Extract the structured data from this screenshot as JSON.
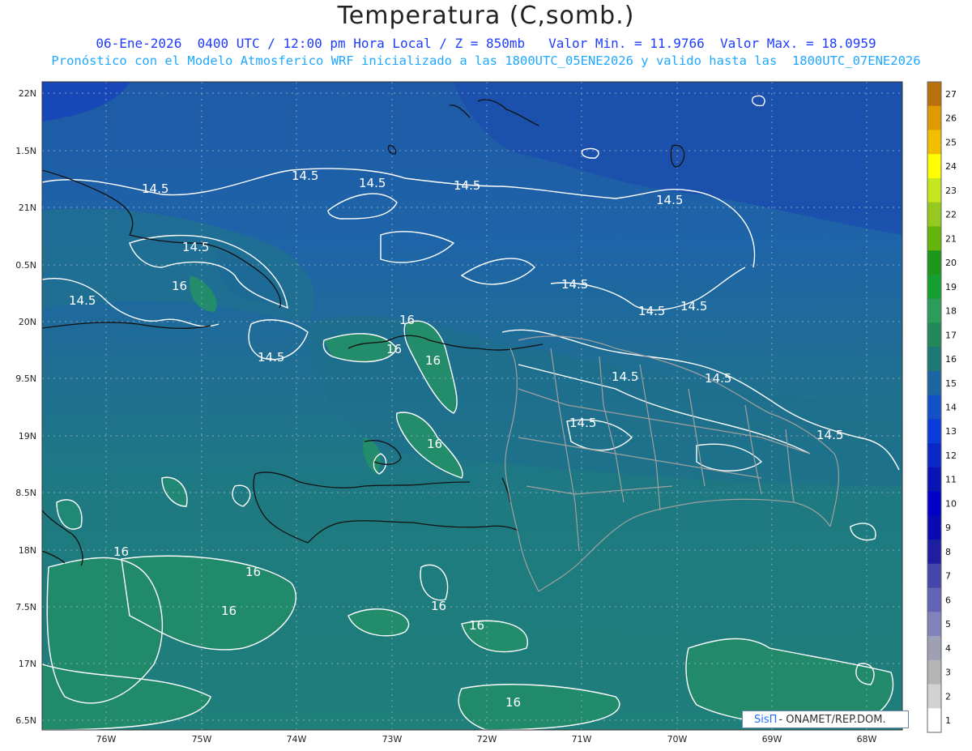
{
  "title": "Temperatura (C,somb.)",
  "subtitle_line1": "06-Ene-2026  0400 UTC / 12:00 pm Hora Local / Z = 850mb   Valor Min. = 11.9766  Valor Max. = 18.0959",
  "subtitle_line2": "Pronóstico con el Modelo Atmosferico WRF inicializado a las 1800UTC_05ENE2026 y valido hasta las  1800UTC_07ENE2026",
  "lat_labels": [
    "22N",
    "1.5N",
    "21N",
    "0.5N",
    "20N",
    "9.5N",
    "19N",
    "8.5N",
    "18N",
    "7.5N",
    "17N",
    "6.5N"
  ],
  "lon_labels": [
    "76W",
    "75W",
    "74W",
    "73W",
    "72W",
    "71W",
    "70W",
    "69W",
    "68W"
  ],
  "colorbar": {
    "levels": [
      "27",
      "26",
      "25",
      "24",
      "23",
      "22",
      "21",
      "20",
      "19",
      "18",
      "17",
      "16",
      "15",
      "14",
      "13",
      "12",
      "11",
      "10",
      "9",
      "8",
      "7",
      "6",
      "5",
      "4",
      "3",
      "2",
      "1"
    ],
    "colors": [
      "#b8700a",
      "#e09a00",
      "#f0c000",
      "#ffff00",
      "#c8e61e",
      "#96c81e",
      "#64b40a",
      "#1e9619",
      "#14a032",
      "#2d9b5a",
      "#23875a",
      "#1e7873",
      "#1e64a0",
      "#1450c8",
      "#0a3cdc",
      "#0a28c8",
      "#0a14b4",
      "#0000c8",
      "#0a0ab4",
      "#1e1ea0",
      "#4646aa",
      "#6464b4",
      "#8282be",
      "#a0a0b4",
      "#b4b4b4",
      "#d2d2d2",
      "#ffffff"
    ]
  },
  "contour_labels": [
    "14.5",
    "14.5",
    "14.5",
    "14.5",
    "14.5",
    "14.5",
    "14.5",
    "14.5",
    "14.5",
    "14.5",
    "14.5",
    "14.5",
    "14.5",
    "14.5",
    "14.5",
    "16",
    "16",
    "16",
    "16",
    "16",
    "16",
    "16",
    "16",
    "16",
    "16",
    "16"
  ],
  "credit": {
    "brand": "SisΠ",
    "text": "- ONAMET/REP.DOM."
  }
}
